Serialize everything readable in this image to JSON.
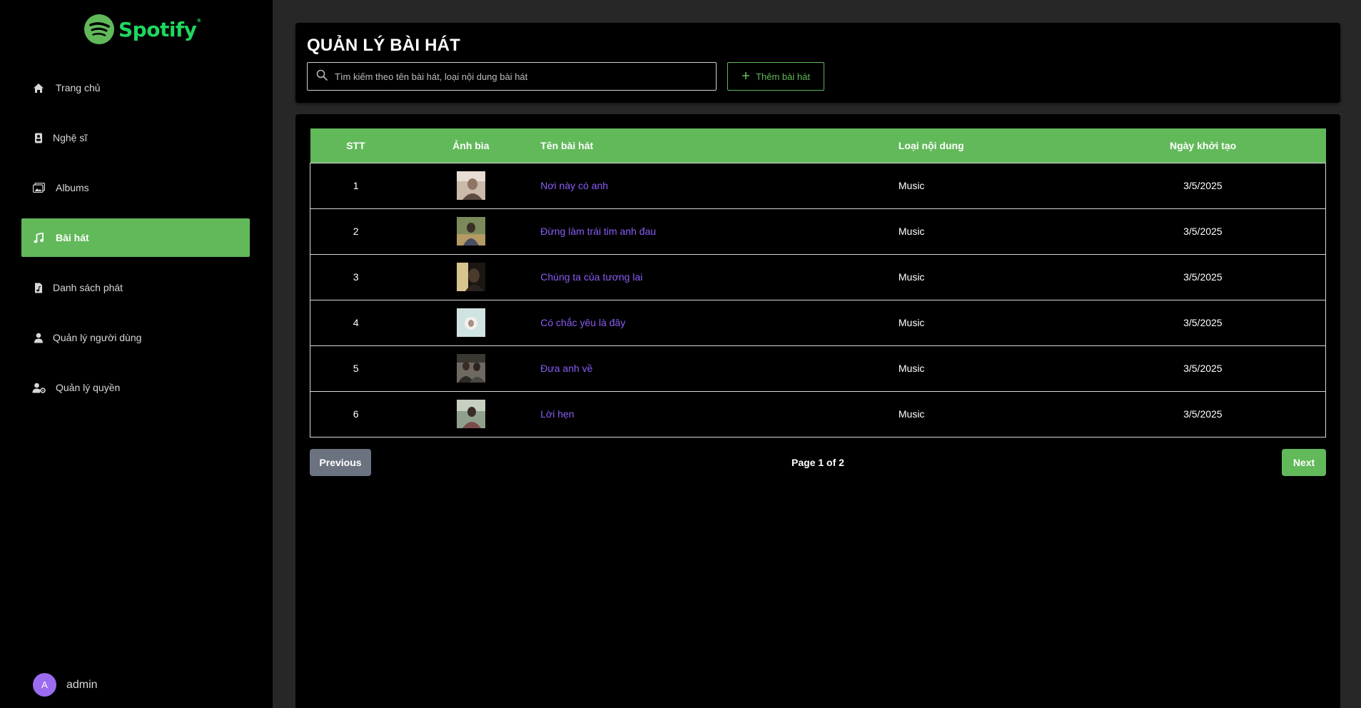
{
  "brand": {
    "name": "Spotify",
    "mark": "®",
    "color": "#1ed760"
  },
  "sidebar": {
    "items": [
      {
        "label": "Trang chủ",
        "icon": "home-icon",
        "active": false
      },
      {
        "label": "Nghệ sĩ",
        "icon": "artist-icon",
        "active": false
      },
      {
        "label": "Albums",
        "icon": "albums-icon",
        "active": false
      },
      {
        "label": "Bài hát",
        "icon": "music-note-icon",
        "active": true
      },
      {
        "label": "Danh sách phát",
        "icon": "playlist-icon",
        "active": false
      },
      {
        "label": "Quản lý người dùng",
        "icon": "user-icon",
        "active": false
      },
      {
        "label": "Quản lý quyền",
        "icon": "user-settings-icon",
        "active": false
      }
    ],
    "user": {
      "initial": "A",
      "name": "admin"
    }
  },
  "header": {
    "title": "QUẢN LÝ BÀI HÁT",
    "search_placeholder": "Tìm kiếm theo tên bài hát, loại nội dung bài hát",
    "search_value": "",
    "add_button": "Thêm bài hát"
  },
  "table": {
    "columns": [
      "STT",
      "Ảnh bìa",
      "Tên bài hát",
      "Loại nội dung",
      "Ngày khởi tạo"
    ],
    "rows": [
      {
        "stt": "1",
        "name": "Nơi này có anh",
        "type": "Music",
        "date": "3/5/2025"
      },
      {
        "stt": "2",
        "name": "Đừng làm trái tim anh đau",
        "type": "Music",
        "date": "3/5/2025"
      },
      {
        "stt": "3",
        "name": "Chúng ta của tương lai",
        "type": "Music",
        "date": "3/5/2025"
      },
      {
        "stt": "4",
        "name": "Có chắc yêu là đây",
        "type": "Music",
        "date": "3/5/2025"
      },
      {
        "stt": "5",
        "name": "Đưa anh về",
        "type": "Music",
        "date": "3/5/2025"
      },
      {
        "stt": "6",
        "name": "Lời hẹn",
        "type": "Music",
        "date": "3/5/2025"
      }
    ]
  },
  "pagination": {
    "previous": "Previous",
    "next": "Next",
    "info": "Page 1 of 2"
  },
  "colors": {
    "accent": "#62b95a",
    "link": "#8b5cf6",
    "disabled": "#6b7280"
  }
}
